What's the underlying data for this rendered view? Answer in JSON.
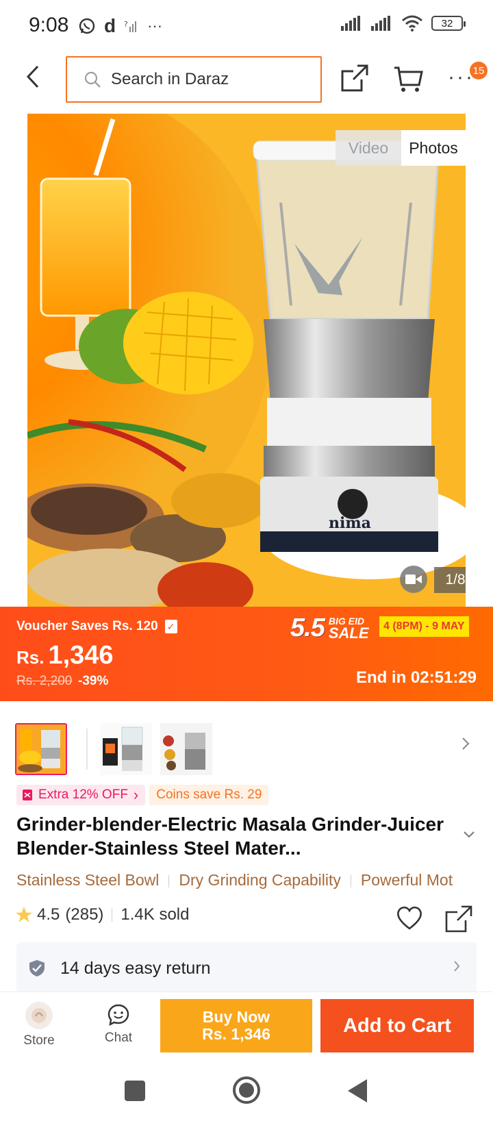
{
  "status_bar": {
    "time": "9:08",
    "left_icons": [
      "whatsapp-icon",
      "daraz-d-icon",
      "signal-question-icon",
      "more-dots"
    ],
    "left_glyph_d": "d",
    "left_glyph_dots": "···",
    "battery": "32"
  },
  "header": {
    "search_placeholder": "Search in Daraz",
    "more_label": "···",
    "badge_count": "15",
    "accent_color": "#f57224"
  },
  "gallery": {
    "tab_video": "Video",
    "tab_photos": "Photos",
    "page_indicator": "1/8",
    "blender_brand": "nima"
  },
  "price_banner": {
    "voucher_text": "Voucher Saves Rs. 120",
    "voucher_check": "✓",
    "currency": "Rs.",
    "price": "1,346",
    "original_price": "Rs. 2,200",
    "discount": "-39%",
    "sale_number": "5.5",
    "sale_line1": "BIG EID",
    "sale_line2": "SALE",
    "sale_dates": "4 (8PM) - 9 MAY",
    "countdown": "End in 02:51:29"
  },
  "promos": {
    "extra_off": "Extra 12% OFF",
    "extra_off_arrow": "›",
    "coins": "Coins save Rs. 29"
  },
  "product": {
    "title": "Grinder-blender-Electric Masala Grinder-Juicer Blender-Stainless Steel Mater...",
    "features": [
      "Stainless Steel Bowl",
      "Dry Grinding Capability",
      "Powerful Mot"
    ],
    "rating": "4.5",
    "reviews": "(285)",
    "sold": "1.4K sold",
    "return_policy": "14 days easy return"
  },
  "bottom_bar": {
    "store_label": "Store",
    "chat_label": "Chat",
    "buy_now_label": "Buy Now",
    "buy_now_price": "Rs. 1,346",
    "add_to_cart_label": "Add to Cart"
  }
}
